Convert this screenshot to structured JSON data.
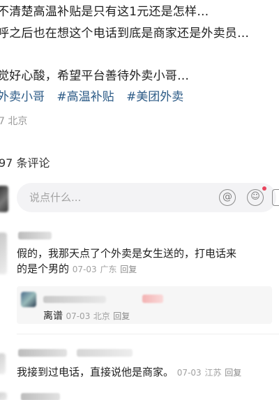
{
  "post": {
    "line1": "不清楚高温补贴是只有这1元还是怎样…",
    "line2": "呼之后也在想这个电话到底是商家还是外卖员…",
    "line3": "觉好心酸，希望平台善待外卖小哥…",
    "tags": [
      "外卖小哥",
      "#高温补贴",
      "#美团外卖"
    ],
    "location_meta": "7 北京"
  },
  "comments_header": {
    "count_text": "97 条评论"
  },
  "input_bar": {
    "placeholder": "说点什么...",
    "at_icon": "@",
    "emoji_icon": "☺"
  },
  "comments": [
    {
      "text_line1": "假的，我那天点了个外卖是女生送的，打电话来",
      "text_line2": "的是个男的",
      "date": "07-03",
      "location": "广东",
      "reply_label": "回复",
      "reply": {
        "text": "离谱",
        "date": "07-03",
        "location": "北京",
        "reply_label": "回复"
      }
    },
    {
      "text": "我接到过电话，直接说他是商家。",
      "date": "07-03",
      "location": "江苏",
      "reply_label": "回复"
    }
  ],
  "colors": {
    "tag": "#2b5a86",
    "meta": "#a0a0a0",
    "input_bg": "#f3f3f5",
    "notify_dot": "#e8465e"
  },
  "icons": [
    "at-icon",
    "emoji-icon",
    "image-icon"
  ]
}
